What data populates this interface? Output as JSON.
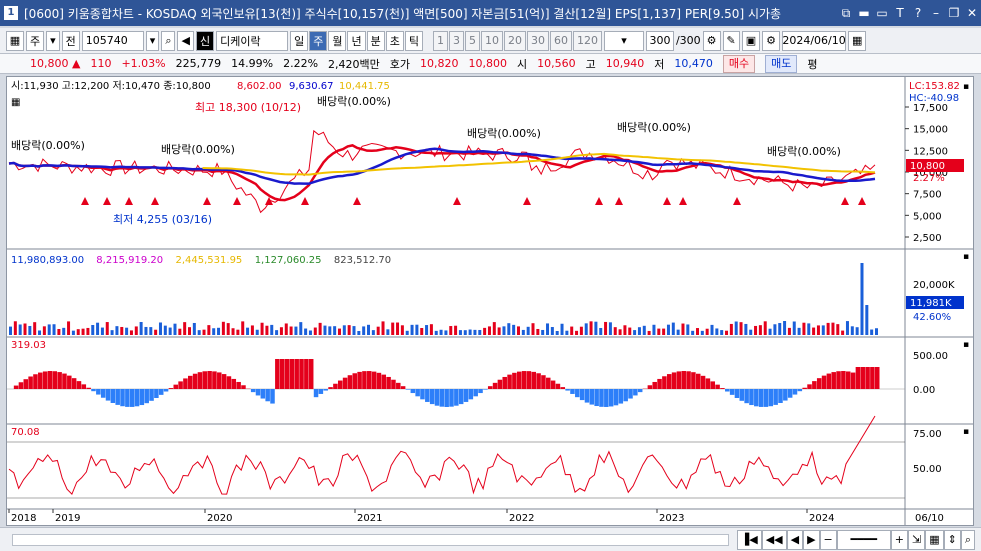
{
  "window": {
    "number": "1",
    "title": "[0600] 키움종합차트 - KOSDAQ 외국인보유[13(천)] 주식수[10,157(천)] 액면[500] 자본금[51(억)] 결산[12월] EPS[1,137] PER[9.50] 시가총"
  },
  "toolbar": {
    "type_main": "주",
    "type_prev": "전",
    "code": "105740",
    "stock_name": "디케이락",
    "periods": [
      "일",
      "주",
      "월",
      "년",
      "분",
      "초",
      "틱"
    ],
    "active_period": "주",
    "minutes": [
      "1",
      "3",
      "5",
      "10",
      "20",
      "30",
      "60",
      "120"
    ],
    "count": "300",
    "count_total": "/300",
    "date": "2024/06/10"
  },
  "quote": {
    "price": "10,800",
    "change": "110",
    "change_pct": "+1.03%",
    "volume": "225,779",
    "turnover_pct": "14.99%",
    "ratio": "2.22%",
    "trade_value": "2,420백만",
    "bid_label": "호가",
    "bid1": "10,820",
    "bid2": "10,800",
    "open_label": "시",
    "open": "10,560",
    "high_label": "고",
    "high": "10,940",
    "low_label": "저",
    "low": "10,470",
    "buy_label": "매수",
    "sell_label": "매도",
    "eval_label": "평"
  },
  "price_panel": {
    "ohlc_text": "시:11,930 고:12,200 저:10,470 종:10,800",
    "ma_values": [
      "8,602.00",
      "9,630.67",
      "10,441.75"
    ],
    "ma_colors": [
      "#e4001b",
      "#0000cc",
      "#e6b800"
    ],
    "max_label": "최고 18,300 (10/12)",
    "min_label": "최저 4,255 (03/16)",
    "dividend_label": "배당락(0.00%)",
    "lc_label": "LC:153.82",
    "hc_label": "HC:-40.98",
    "y_ticks": [
      "17,500",
      "15,000",
      "12,500",
      "10,000",
      "7,500",
      "5,000",
      "2,500"
    ],
    "pct_tick": "2.27%",
    "current_tag": "10,800"
  },
  "volume_panel": {
    "values": [
      "11,980,893.00",
      "8,215,919.20",
      "2,445,531.95",
      "1,127,060.25",
      "823,512.70"
    ],
    "value_colors": [
      "#0033cc",
      "#cc00cc",
      "#e6b800",
      "#2a8a2a",
      "#444444"
    ],
    "y_ticks": [
      "20,000K"
    ],
    "current_tag": "11,981K",
    "pct_tag": "42.60%"
  },
  "macd_panel": {
    "value": "319.03",
    "y_ticks": [
      "500.00",
      "0.00"
    ]
  },
  "rsi_panel": {
    "value": "70.08",
    "y_ticks": [
      "75.00",
      "50.00"
    ]
  },
  "x_axis": {
    "labels": [
      "2018",
      "2019",
      "2020",
      "2021",
      "2022",
      "2023",
      "2024"
    ],
    "end_label": "06/10"
  },
  "chart_data": {
    "type": "line",
    "title": "",
    "xlabel": "",
    "ylabel": "",
    "ylim": [
      2500,
      17500
    ],
    "x": [
      "2018",
      "2019",
      "2020",
      "2021",
      "2022",
      "2023",
      "2024"
    ],
    "series": [
      {
        "name": "",
        "values": [
          11000,
          10500,
          7000,
          14500,
          13000,
          12500,
          10800
        ]
      }
    ]
  }
}
